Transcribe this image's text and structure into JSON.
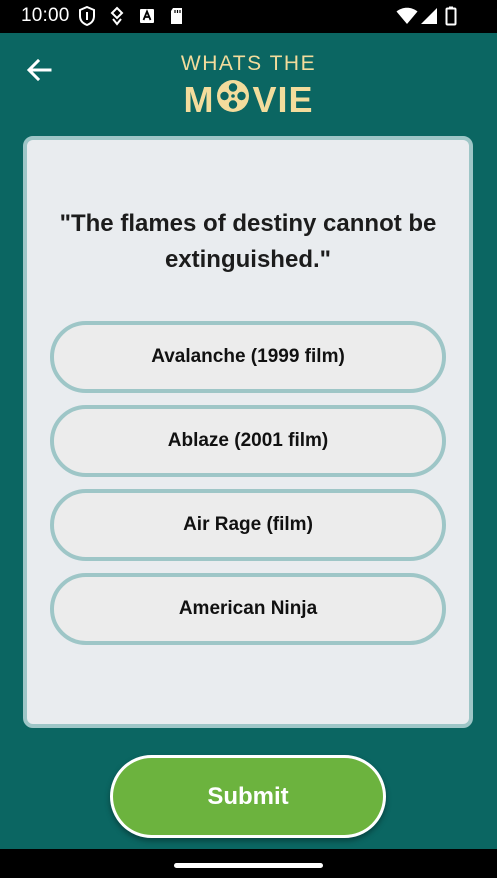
{
  "status_bar": {
    "time": "10:00"
  },
  "header": {
    "back_icon": "arrow-left-icon",
    "logo_top": "WHATS THE",
    "logo_bottom_before": "M",
    "logo_reel_icon": "film-reel-icon",
    "logo_bottom_after": "VIE"
  },
  "quiz": {
    "question": "\"The flames of destiny cannot be extinguished.\"",
    "options": [
      "Avalanche (1999 film)",
      "Ablaze (2001 film)",
      "Air Rage (film)",
      "American Ninja"
    ]
  },
  "submit_label": "Submit",
  "colors": {
    "background": "#0b6662",
    "logo": "#f3dc9c",
    "card": "#e9ecef",
    "card_border": "#9ec6c7",
    "submit": "#6cb33e"
  }
}
